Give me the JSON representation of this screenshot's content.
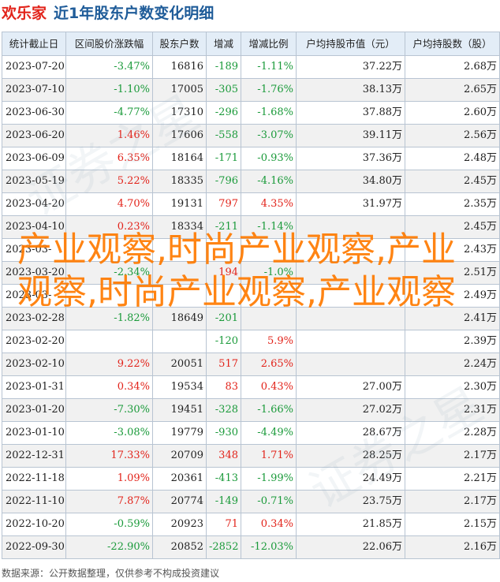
{
  "header": {
    "brand": "欢乐家",
    "title": "近1年股东户数变化明细"
  },
  "table": {
    "columns": [
      "统计截止日",
      "区间股价涨跌幅",
      "股东户数",
      "增减",
      "增减比例",
      "户均持股市值（元）",
      "户均持股数（股）"
    ],
    "rows": [
      [
        "2023-07-20",
        "-3.47%",
        "16816",
        "-189",
        "-1.11%",
        "37.22万",
        "2.68万"
      ],
      [
        "2023-07-10",
        "-1.10%",
        "17005",
        "-305",
        "-1.76%",
        "38.13万",
        "2.65万"
      ],
      [
        "2023-06-30",
        "-4.77%",
        "17310",
        "-296",
        "-1.68%",
        "37.88万",
        "2.60万"
      ],
      [
        "2023-06-20",
        "1.46%",
        "17606",
        "-558",
        "-3.07%",
        "39.11万",
        "2.56万"
      ],
      [
        "2023-06-09",
        "6.35%",
        "18164",
        "-171",
        "-0.93%",
        "37.36万",
        "2.48万"
      ],
      [
        "2023-05-19",
        "5.22%",
        "18335",
        "-796",
        "-4.16%",
        "34.80万",
        "2.45万"
      ],
      [
        "2023-04-20",
        "4.70%",
        "19131",
        "797",
        "4.35%",
        "31.97万",
        "2.35万"
      ],
      [
        "2023-04-10",
        "0.23%",
        "18334",
        "-211",
        "-1.14%",
        "",
        "2.45万"
      ],
      [
        "2023-03-",
        "",
        "",
        "",
        "",
        "",
        "2.43万"
      ],
      [
        "2023-03-20",
        "-2.34%",
        "",
        "194",
        "-1.0%",
        "",
        "2.51万"
      ],
      [
        "2023-03-",
        "",
        "",
        "",
        "",
        "",
        "2.49万"
      ],
      [
        "2023-02-28",
        "-1.82%",
        "18649",
        "-201",
        "",
        "",
        "2.41万"
      ],
      [
        "2023-02-20",
        "",
        "",
        "-120",
        "5.9%",
        "",
        "2.39万"
      ],
      [
        "2023-02-10",
        "9.22%",
        "20051",
        "517",
        "2.65%",
        "",
        "2.24万"
      ],
      [
        "2023-01-31",
        "0.34%",
        "19534",
        "83",
        "0.43%",
        "27.00万",
        "2.30万"
      ],
      [
        "2023-01-20",
        "-7.30%",
        "19451",
        "-328",
        "-1.66%",
        "27.02万",
        "2.31万"
      ],
      [
        "2023-01-10",
        "-3.08%",
        "19779",
        "-930",
        "-4.49%",
        "28.67万",
        "2.28万"
      ],
      [
        "2022-12-31",
        "17.33%",
        "20709",
        "348",
        "1.71%",
        "28.25万",
        "2.17万"
      ],
      [
        "2022-11-18",
        "1.09%",
        "20361",
        "-413",
        "-1.99%",
        "24.49万",
        "2.21万"
      ],
      [
        "2022-11-10",
        "7.87%",
        "20774",
        "-149",
        "-0.71%",
        "23.75万",
        "2.17万"
      ],
      [
        "2022-10-20",
        "-0.59%",
        "20923",
        "71",
        "0.34%",
        "21.85万",
        "2.15万"
      ],
      [
        "2022-09-30",
        "-22.90%",
        "20852",
        "-2852",
        "-12.03%",
        "22.06万",
        "2.16万"
      ]
    ]
  },
  "watermark": {
    "overlay_text": "产业观察,时尚产业观察,产业观察,时尚产业观察,产业观察",
    "faint_text": "证券之星"
  },
  "footer": {
    "source": "数据来源：公开数据整理，仅供参考不构成投资建议"
  },
  "colors": {
    "up": "#e2231a",
    "down": "#1a9a3a",
    "header_bg": "#e3edf7",
    "title": "#1f5c99",
    "overlay": "#ff7a00"
  }
}
